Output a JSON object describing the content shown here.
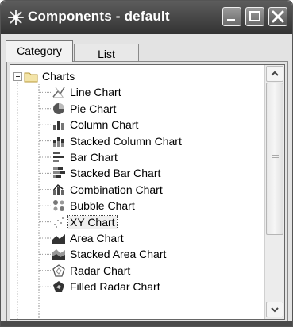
{
  "window": {
    "title": "Components - default"
  },
  "tabs": [
    {
      "label": "Category",
      "active": true
    },
    {
      "label": "List",
      "active": false
    }
  ],
  "tree": {
    "root": {
      "label": "Charts",
      "expanded": true,
      "expander": "⊟",
      "icon": "folder-icon"
    },
    "items": [
      {
        "label": "Line Chart",
        "icon": "line-chart-icon"
      },
      {
        "label": "Pie Chart",
        "icon": "pie-chart-icon"
      },
      {
        "label": "Column Chart",
        "icon": "column-chart-icon"
      },
      {
        "label": "Stacked Column Chart",
        "icon": "stacked-column-chart-icon"
      },
      {
        "label": "Bar Chart",
        "icon": "bar-chart-icon"
      },
      {
        "label": "Stacked Bar Chart",
        "icon": "stacked-bar-chart-icon"
      },
      {
        "label": "Combination Chart",
        "icon": "combination-chart-icon"
      },
      {
        "label": "Bubble Chart",
        "icon": "bubble-chart-icon"
      },
      {
        "label": "XY Chart",
        "icon": "xy-chart-icon",
        "selected": true
      },
      {
        "label": "Area Chart",
        "icon": "area-chart-icon"
      },
      {
        "label": "Stacked Area Chart",
        "icon": "stacked-area-chart-icon"
      },
      {
        "label": "Radar Chart",
        "icon": "radar-chart-icon"
      },
      {
        "label": "Filled Radar Chart",
        "icon": "filled-radar-chart-icon"
      }
    ]
  },
  "colors": {
    "titlebar": "#4a4a4a",
    "chrome": "#e3e3e3",
    "tree_bg": "#ffffff"
  }
}
